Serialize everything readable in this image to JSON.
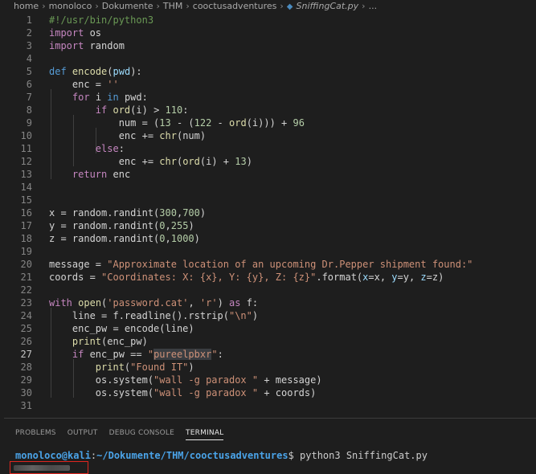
{
  "breadcrumb": {
    "items": [
      "home",
      "monoloco",
      "Dokumente",
      "THM",
      "cooctusadventures"
    ],
    "file": "SniffingCat.py",
    "trailing": "..."
  },
  "editor": {
    "active_line": 27,
    "lines": [
      {
        "n": "1",
        "tokens": [
          [
            "cm",
            "#!/usr/bin/python3"
          ]
        ]
      },
      {
        "n": "2",
        "tokens": [
          [
            "ctl",
            "import"
          ],
          [
            "",
            " os"
          ]
        ]
      },
      {
        "n": "3",
        "tokens": [
          [
            "ctl",
            "import"
          ],
          [
            "",
            " random"
          ]
        ]
      },
      {
        "n": "4",
        "tokens": []
      },
      {
        "n": "5",
        "tokens": [
          [
            "kw",
            "def"
          ],
          [
            "",
            " "
          ],
          [
            "fn",
            "encode"
          ],
          [
            "",
            "("
          ],
          [
            "var",
            "pwd"
          ],
          [
            "",
            "):"
          ]
        ]
      },
      {
        "n": "6",
        "tokens": [
          [
            "",
            "    enc = "
          ],
          [
            "str",
            "''"
          ]
        ]
      },
      {
        "n": "7",
        "tokens": [
          [
            "",
            "    "
          ],
          [
            "ctl",
            "for"
          ],
          [
            "",
            " i "
          ],
          [
            "kw",
            "in"
          ],
          [
            "",
            " pwd:"
          ]
        ]
      },
      {
        "n": "8",
        "tokens": [
          [
            "",
            "        "
          ],
          [
            "ctl",
            "if"
          ],
          [
            "",
            " "
          ],
          [
            "fn",
            "ord"
          ],
          [
            "",
            "(i) > "
          ],
          [
            "num",
            "110"
          ],
          [
            "",
            ":"
          ]
        ]
      },
      {
        "n": "9",
        "tokens": [
          [
            "",
            "            num = ("
          ],
          [
            "num",
            "13"
          ],
          [
            "",
            " - ("
          ],
          [
            "num",
            "122"
          ],
          [
            "",
            " - "
          ],
          [
            "fn",
            "ord"
          ],
          [
            "",
            "(i))) + "
          ],
          [
            "num",
            "96"
          ]
        ]
      },
      {
        "n": "10",
        "tokens": [
          [
            "",
            "            enc += "
          ],
          [
            "fn",
            "chr"
          ],
          [
            "",
            "(num)"
          ]
        ]
      },
      {
        "n": "11",
        "tokens": [
          [
            "",
            "        "
          ],
          [
            "ctl",
            "else"
          ],
          [
            "",
            ":"
          ]
        ]
      },
      {
        "n": "12",
        "tokens": [
          [
            "",
            "            enc += "
          ],
          [
            "fn",
            "chr"
          ],
          [
            "",
            "("
          ],
          [
            "fn",
            "ord"
          ],
          [
            "",
            "(i) + "
          ],
          [
            "num",
            "13"
          ],
          [
            "",
            ")"
          ]
        ]
      },
      {
        "n": "13",
        "tokens": [
          [
            "",
            "    "
          ],
          [
            "ctl",
            "return"
          ],
          [
            "",
            " enc"
          ]
        ]
      },
      {
        "n": "14",
        "tokens": []
      },
      {
        "n": "15",
        "tokens": []
      },
      {
        "n": "16",
        "tokens": [
          [
            "",
            "x = random.randint("
          ],
          [
            "num",
            "300"
          ],
          [
            "",
            ","
          ],
          [
            "num",
            "700"
          ],
          [
            "",
            ")"
          ]
        ]
      },
      {
        "n": "17",
        "tokens": [
          [
            "",
            "y = random.randint("
          ],
          [
            "num",
            "0"
          ],
          [
            "",
            ","
          ],
          [
            "num",
            "255"
          ],
          [
            "",
            ")"
          ]
        ]
      },
      {
        "n": "18",
        "tokens": [
          [
            "",
            "z = random.randint("
          ],
          [
            "num",
            "0"
          ],
          [
            "",
            ","
          ],
          [
            "num",
            "1000"
          ],
          [
            "",
            ")"
          ]
        ]
      },
      {
        "n": "19",
        "tokens": []
      },
      {
        "n": "20",
        "tokens": [
          [
            "",
            "message = "
          ],
          [
            "str",
            "\"Approximate location of an upcoming Dr.Pepper shipment found:\""
          ]
        ]
      },
      {
        "n": "21",
        "tokens": [
          [
            "",
            "coords = "
          ],
          [
            "str",
            "\"Coordinates: X: {x}, Y: {y}, Z: {z}\""
          ],
          [
            "",
            ".format("
          ],
          [
            "var",
            "x"
          ],
          [
            "",
            "=x, "
          ],
          [
            "var",
            "y"
          ],
          [
            "",
            "=y, "
          ],
          [
            "var",
            "z"
          ],
          [
            "",
            "=z)"
          ]
        ]
      },
      {
        "n": "22",
        "tokens": []
      },
      {
        "n": "23",
        "tokens": [
          [
            "ctl",
            "with"
          ],
          [
            "",
            " "
          ],
          [
            "fn",
            "open"
          ],
          [
            "",
            "("
          ],
          [
            "str",
            "'password.cat'"
          ],
          [
            "",
            ", "
          ],
          [
            "str",
            "'r'"
          ],
          [
            "",
            ") "
          ],
          [
            "ctl",
            "as"
          ],
          [
            "",
            " f:"
          ]
        ]
      },
      {
        "n": "24",
        "tokens": [
          [
            "",
            "    line = f.readline().rstrip("
          ],
          [
            "str",
            "\"\\n\""
          ],
          [
            "",
            ")"
          ]
        ]
      },
      {
        "n": "25",
        "tokens": [
          [
            "",
            "    enc_pw = encode(line)"
          ]
        ]
      },
      {
        "n": "26",
        "tokens": [
          [
            "",
            "    "
          ],
          [
            "fn",
            "print"
          ],
          [
            "",
            "(enc_pw)"
          ]
        ]
      },
      {
        "n": "27",
        "tokens": [
          [
            "",
            "    "
          ],
          [
            "ctl",
            "if"
          ],
          [
            "",
            " enc_pw == "
          ],
          [
            "str",
            "\""
          ],
          [
            "str hl",
            "pureelpbxr"
          ],
          [
            "str",
            "\""
          ],
          [
            "",
            ":"
          ]
        ]
      },
      {
        "n": "28",
        "tokens": [
          [
            "",
            "        "
          ],
          [
            "fn",
            "print"
          ],
          [
            "",
            "("
          ],
          [
            "str",
            "\"Found IT\""
          ],
          [
            "",
            ")"
          ]
        ]
      },
      {
        "n": "29",
        "tokens": [
          [
            "",
            "        os.system("
          ],
          [
            "str",
            "\"wall -g paradox \""
          ],
          [
            "",
            " + message)"
          ]
        ]
      },
      {
        "n": "30",
        "tokens": [
          [
            "",
            "        os.system("
          ],
          [
            "str",
            "\"wall -g paradox \""
          ],
          [
            "",
            " + coords)"
          ]
        ]
      },
      {
        "n": "31",
        "tokens": []
      }
    ]
  },
  "panel": {
    "tabs": [
      {
        "label": "PROBLEMS",
        "active": false
      },
      {
        "label": "OUTPUT",
        "active": false
      },
      {
        "label": "DEBUG CONSOLE",
        "active": false
      },
      {
        "label": "TERMINAL",
        "active": true
      }
    ],
    "terminal": {
      "user": "monoloco@kali",
      "sep": ":",
      "path": "~/Dokumente/THM/cooctusadventures",
      "prompt_char": "$",
      "command": " python3 SniffingCat.py"
    }
  },
  "colors": {
    "background": "#1e1e1e",
    "keyword": "#569cd6",
    "control": "#c586c0",
    "function": "#dcdcaa",
    "string": "#ce9178",
    "number": "#b5cea8",
    "comment": "#6a9955",
    "terminal_prompt": "#4aa3e8",
    "redaction_box": "#e0261f"
  }
}
